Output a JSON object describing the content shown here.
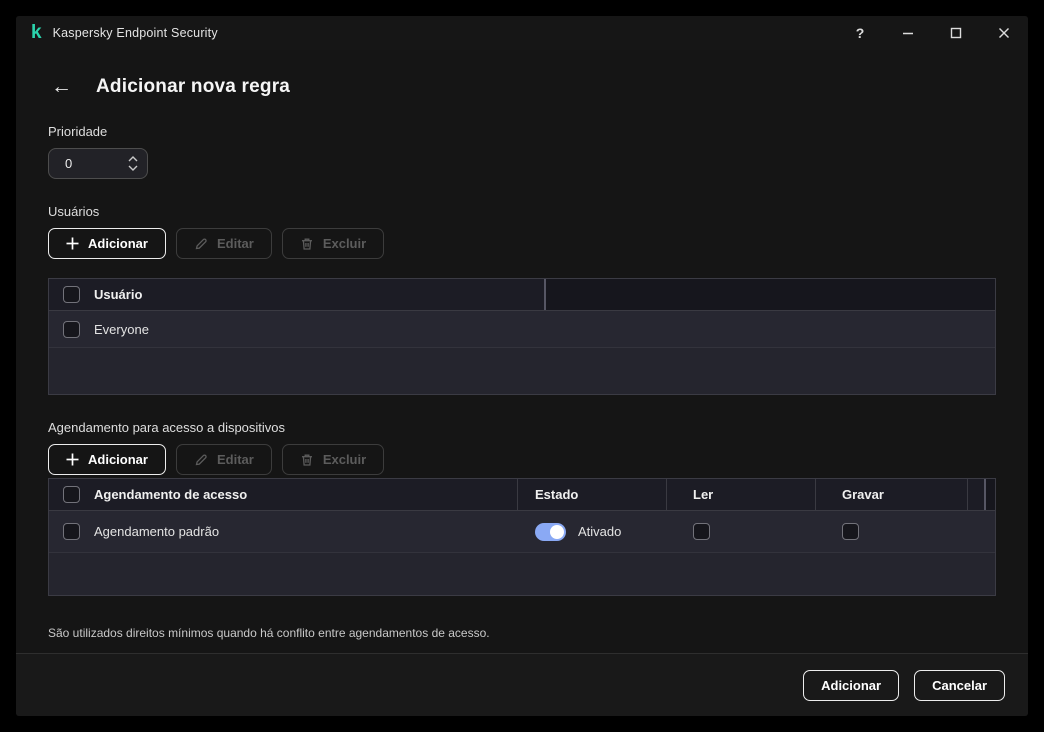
{
  "window": {
    "title": "Kaspersky Endpoint Security",
    "logo_glyph": "k",
    "controls": {
      "help": "?"
    }
  },
  "icons": {
    "back": "←",
    "logo": "kaspersky-logo",
    "help": "question-mark-icon",
    "minimize": "minimize-icon",
    "maximize": "maximize-icon",
    "close": "close-icon",
    "add": "plus-icon",
    "edit": "pencil-icon",
    "delete": "trash-icon",
    "spin_up": "chevron-up-icon",
    "spin_down": "chevron-down-icon"
  },
  "page": {
    "title": "Adicionar nova regra"
  },
  "priority": {
    "label": "Prioridade",
    "value": "0"
  },
  "users_section": {
    "label": "Usuários",
    "toolbar": {
      "add": "Adicionar",
      "edit": "Editar",
      "delete": "Excluir"
    },
    "table": {
      "header": "Usuário",
      "rows": [
        {
          "name": "Everyone",
          "checked": false
        }
      ]
    }
  },
  "schedule_section": {
    "label": "Agendamento para acesso a dispositivos",
    "toolbar": {
      "add": "Adicionar",
      "edit": "Editar",
      "delete": "Excluir"
    },
    "table": {
      "columns": [
        "Agendamento de acesso",
        "Estado",
        "Ler",
        "Gravar"
      ],
      "rows": [
        {
          "name": "Agendamento padrão",
          "state_label": "Ativado",
          "state_on": true,
          "read": false,
          "write": false
        }
      ]
    }
  },
  "note": "São utilizados direitos mínimos quando há conflito entre agendamentos de acesso.",
  "footer": {
    "add": "Adicionar",
    "cancel": "Cancelar"
  },
  "colors": {
    "accent_teal": "#2bd4ad",
    "toggle_on": "#8aa9f4",
    "table_bg": "#25252e",
    "window_bg": "#151515"
  }
}
